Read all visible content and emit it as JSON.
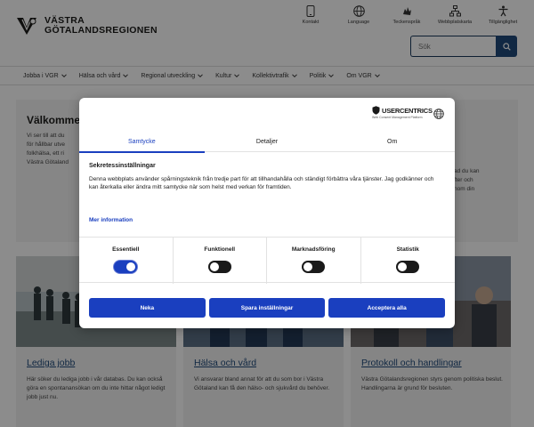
{
  "header": {
    "logo_line1": "VÄSTRA",
    "logo_line2": "GÖTALANDSREGIONEN",
    "top_links": [
      {
        "label": "Kontakt",
        "icon": "phone-icon"
      },
      {
        "label": "Language",
        "icon": "globe-icon"
      },
      {
        "label": "Teckenspråk",
        "icon": "sign-language-icon"
      },
      {
        "label": "Webbplatskarta",
        "icon": "sitemap-icon"
      },
      {
        "label": "Tillgänglighet",
        "icon": "accessibility-icon"
      }
    ],
    "search_placeholder": "Sök"
  },
  "nav": {
    "items": [
      "Jobba i VGR",
      "Hälsa och vård",
      "Regional utveckling",
      "Kultur",
      "Kollektivtrafik",
      "Politik",
      "Om VGR"
    ]
  },
  "welcome": {
    "title": "Välkomme",
    "text": "Vi ser till att du\nför hållbar utve\nfolkhälsa, ett ri\nVästra Götaland",
    "right_text": "ad du kan\nfter och\nnom din"
  },
  "cards": [
    {
      "title": "Lediga jobb",
      "text": "Här söker du lediga jobb i vår databas. Du kan också göra en spontanansökan om du inte hittar något ledigt jobb just nu."
    },
    {
      "title": "Hälsa och vård",
      "text": "Vi ansvarar bland annat för att du som bor i Västra Götaland kan få den hälso- och sjukvård du behöver."
    },
    {
      "title": "Protokoll och handlingar",
      "text": "Västra Götalandsregionen styrs genom politiska beslut. Handlingarna är grund för besluten."
    }
  ],
  "consent": {
    "brand_name": "USERCENTRICS",
    "brand_sub": "Web Consent Management Platform",
    "tabs": [
      {
        "label": "Samtycke",
        "active": true
      },
      {
        "label": "Detaljer",
        "active": false
      },
      {
        "label": "Om",
        "active": false
      }
    ],
    "heading": "Sekretessinställningar",
    "body": "Denna webbplats använder spårningsteknik från tredje part för att tillhandahålla och ständigt förbättra våra tjänster. Jag godkänner och kan återkalla eller ändra mitt samtycke när som helst med verkan för framtiden.",
    "more_info": "Mer information",
    "categories": [
      {
        "label": "Essentiell",
        "enabled": true
      },
      {
        "label": "Funktionell",
        "enabled": false
      },
      {
        "label": "Marknadsföring",
        "enabled": false
      },
      {
        "label": "Statistik",
        "enabled": false
      }
    ],
    "buttons": {
      "deny": "Neka",
      "save": "Spara inställningar",
      "accept": "Acceptera alla"
    },
    "accent_color": "#1a3fbf"
  }
}
